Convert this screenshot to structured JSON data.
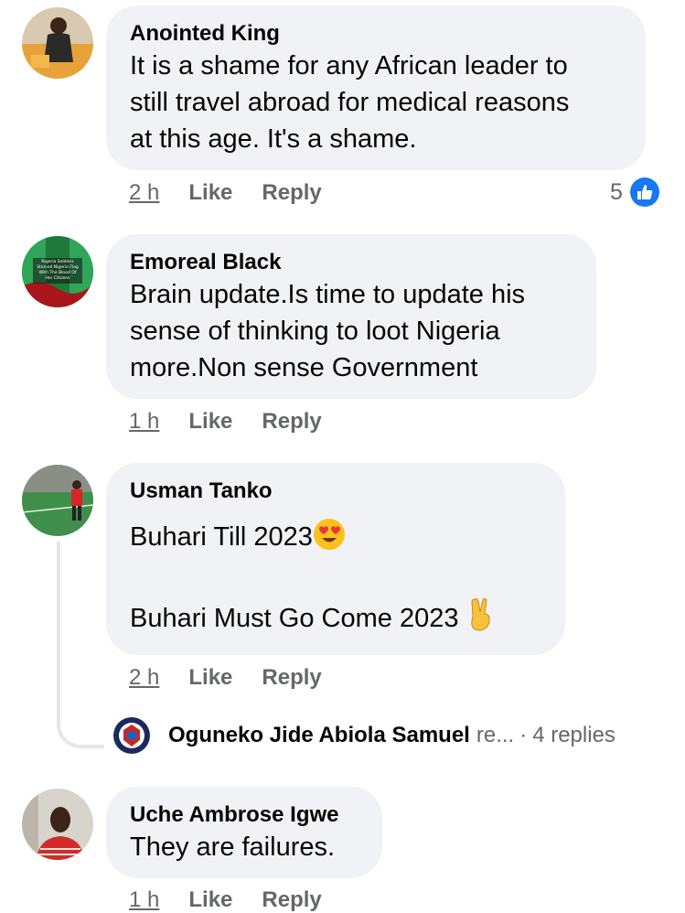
{
  "comments": [
    {
      "author": "Anointed King",
      "text_lines": [
        "It is a shame for any African leader to",
        "still travel abroad for medical reasons",
        "at this age. It's a shame."
      ],
      "time": "2 h",
      "like_label": "Like",
      "reply_label": "Reply",
      "reaction_count": "5",
      "reaction_icon": "like-icon"
    },
    {
      "author": "Emoreal Black",
      "avatar_caption": [
        "Nigeria Soldiers",
        "Stained Nigeria Flag",
        "With The Blood Of",
        "Her Citizens"
      ],
      "text_lines": [
        "Brain update.Is time to update his",
        "sense of thinking to loot Nigeria",
        "more.Non sense Government"
      ],
      "time": "1 h",
      "like_label": "Like",
      "reply_label": "Reply"
    },
    {
      "author": "Usman Tanko",
      "text_line1": "Buhari Till 2023",
      "text_line1_emoji": "heart-eyes-emoji",
      "text_line2": "Buhari Must Go Come 2023",
      "text_line2_emoji": "victory-hand-emoji",
      "time": "2 h",
      "like_label": "Like",
      "reply_label": "Reply",
      "reply_preview": {
        "name": "Oguneko Jide Abiola Samuel",
        "suffix": "re...",
        "separator": "·",
        "replies": "4 replies"
      }
    },
    {
      "author": "Uche Ambrose Igwe",
      "text_lines": [
        "They are failures."
      ],
      "time": "1 h",
      "like_label": "Like",
      "reply_label": "Reply"
    }
  ],
  "colors": {
    "bubble": "#f0f2f5",
    "muted_text": "#65676b",
    "like_blue": "#1877f2"
  }
}
